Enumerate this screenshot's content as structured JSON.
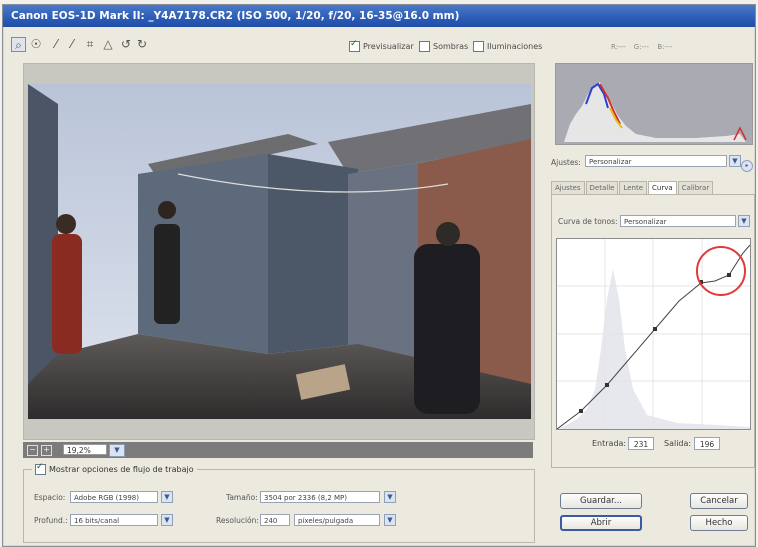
{
  "window": {
    "title": "Canon EOS-1D Mark II:  _Y4A7178.CR2  (ISO 500, 1/20, f/20, 16-35@16.0 mm)"
  },
  "toolbar": {
    "tools": [
      {
        "icon": "zoom-icon",
        "glyph": "🔍"
      },
      {
        "icon": "hand-icon",
        "glyph": "✋"
      },
      {
        "icon": "white-balance-eyedropper-icon",
        "glyph": "✎"
      },
      {
        "icon": "color-sampler-icon",
        "glyph": "✎"
      },
      {
        "icon": "crop-icon",
        "glyph": "⊡"
      },
      {
        "icon": "straighten-icon",
        "glyph": "△"
      },
      {
        "icon": "rotate-left-icon",
        "glyph": "↺"
      },
      {
        "icon": "rotate-right-icon",
        "glyph": "↻"
      }
    ],
    "previsualizar": {
      "label": "Previsualizar",
      "checked": true
    },
    "sombras": {
      "label": "Sombras",
      "checked": false
    },
    "iluminaciones": {
      "label": "Iluminaciones",
      "checked": false
    },
    "rgb_readout": "R:---  G:---  B:---"
  },
  "zoom": {
    "value": "19,2%"
  },
  "workflow": {
    "show_label": "Mostrar opciones de flujo de trabajo",
    "espacio_label": "Espacio:",
    "espacio_value": "Adobe RGB (1998)",
    "profund_label": "Profund.:",
    "profund_value": "16 bits/canal",
    "tamano_label": "Tamaño:",
    "tamano_value": "3504 por 2336 (8,2 MP)",
    "resolucion_label": "Resolución:",
    "resolucion_value": "240",
    "resolucion_unit": "píxeles/pulgada"
  },
  "adjustments": {
    "ajustes_label": "Ajustes:",
    "ajustes_value": "Personalizar",
    "tabs": [
      "Ajustes",
      "Detalle",
      "Lente",
      "Curva",
      "Calibrar"
    ],
    "active_tab": "Curva",
    "curva_label": "Curva de tonos:",
    "curva_value": "Personalizar",
    "entrada_label": "Entrada:",
    "entrada_value": "231",
    "salida_label": "Salida:",
    "salida_value": "196",
    "highlight_color": "#e03a3a"
  },
  "buttons": {
    "guardar": "Guardar...",
    "abrir": "Abrir",
    "cancelar": "Cancelar",
    "hecho": "Hecho"
  }
}
